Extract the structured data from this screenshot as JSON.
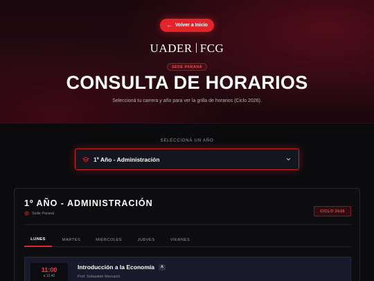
{
  "header": {
    "back_label": "Volver a Inicio",
    "logo_left": "UADER",
    "logo_right": "FCG",
    "sede_badge": "Sede Paraná",
    "title": "CONSULTA DE HORARIOS",
    "subtitle": "Seleccioná tu carrera y año para ver la grilla de horarios (Ciclo 2026)."
  },
  "selector": {
    "label": "SELECCIONÁ UN AÑO",
    "selected": "1º Año - Administración",
    "icon": "graduation-cap-icon"
  },
  "panel": {
    "title": "1º AÑO - ADMINISTRACIÓN",
    "sede": "Sede Paraná",
    "ciclo_badge": "CICLO 2026",
    "tabs": [
      "LUNES",
      "MARTES",
      "MIÉRCOLES",
      "JUEVES",
      "VIERNES"
    ],
    "active_tab": "LUNES",
    "classes": [
      {
        "start": "11:00",
        "end": "a 12:40",
        "name": "Introducción a la Economía",
        "comision": "A",
        "professor": "Prof. Sebastián Mercaich"
      }
    ]
  },
  "colors": {
    "accent": "#e3242b",
    "background": "#0b0b0d",
    "card": "#18192a"
  }
}
